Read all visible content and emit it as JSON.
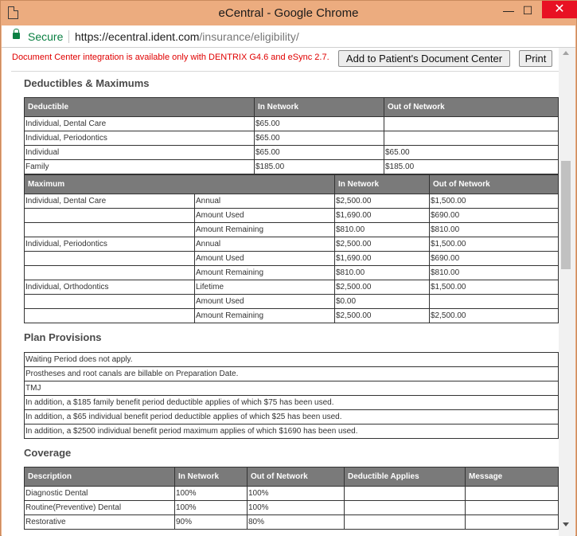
{
  "window": {
    "title": "eCentral - Google Chrome",
    "min": "—",
    "max": "☐",
    "close": "✕"
  },
  "address": {
    "secure": "Secure",
    "url_host": "https://ecentral.ident.com",
    "url_path": "/insurance/eligibility/"
  },
  "header": {
    "notice": "Document Center integration is available only with DENTRIX G4.6 and eSync 2.7.",
    "add_button": "Add to Patient's Document Center",
    "print_button": "Print"
  },
  "deductibles": {
    "title": "Deductibles & Maximums",
    "headers": [
      "Deductible",
      "In Network",
      "Out of Network"
    ],
    "rows": [
      [
        "Individual, Dental Care",
        "$65.00",
        ""
      ],
      [
        "Individual, Periodontics",
        "$65.00",
        ""
      ],
      [
        "Individual",
        "$65.00",
        "$65.00"
      ],
      [
        "Family",
        "$185.00",
        "$185.00"
      ]
    ]
  },
  "maximums": {
    "headers": [
      "Maximum",
      "In Network",
      "Out of Network"
    ],
    "rows": [
      [
        "Individual, Dental Care",
        "Annual",
        "$2,500.00",
        "$1,500.00"
      ],
      [
        "",
        "Amount Used",
        "$1,690.00",
        "$690.00"
      ],
      [
        "",
        "Amount Remaining",
        "$810.00",
        "$810.00"
      ],
      [
        "Individual, Periodontics",
        "Annual",
        "$2,500.00",
        "$1,500.00"
      ],
      [
        "",
        "Amount Used",
        "$1,690.00",
        "$690.00"
      ],
      [
        "",
        "Amount Remaining",
        "$810.00",
        "$810.00"
      ],
      [
        "Individual, Orthodontics",
        "Lifetime",
        "$2,500.00",
        "$1,500.00"
      ],
      [
        "",
        "Amount Used",
        "$0.00",
        ""
      ],
      [
        "",
        "Amount Remaining",
        "$2,500.00",
        "$2,500.00"
      ]
    ]
  },
  "provisions": {
    "title": "Plan Provisions",
    "rows": [
      "Waiting Period does not apply.",
      "Prostheses and root canals are billable on Preparation Date.",
      "TMJ",
      "In addition, a $185 family benefit period deductible applies of which $75 has been used.",
      "In addition, a $65 individual benefit period deductible applies of which $25 has been used.",
      "In addition, a $2500 individual benefit period maximum applies of which $1690 has been used."
    ]
  },
  "coverage": {
    "title": "Coverage",
    "headers": [
      "Description",
      "In Network",
      "Out of Network",
      "Deductible Applies",
      "Message"
    ],
    "rows": [
      [
        "Diagnostic Dental",
        "100%",
        "100%",
        "",
        ""
      ],
      [
        "Routine(Preventive) Dental",
        "100%",
        "100%",
        "",
        ""
      ],
      [
        "Restorative",
        "90%",
        "80%",
        "",
        ""
      ]
    ]
  }
}
